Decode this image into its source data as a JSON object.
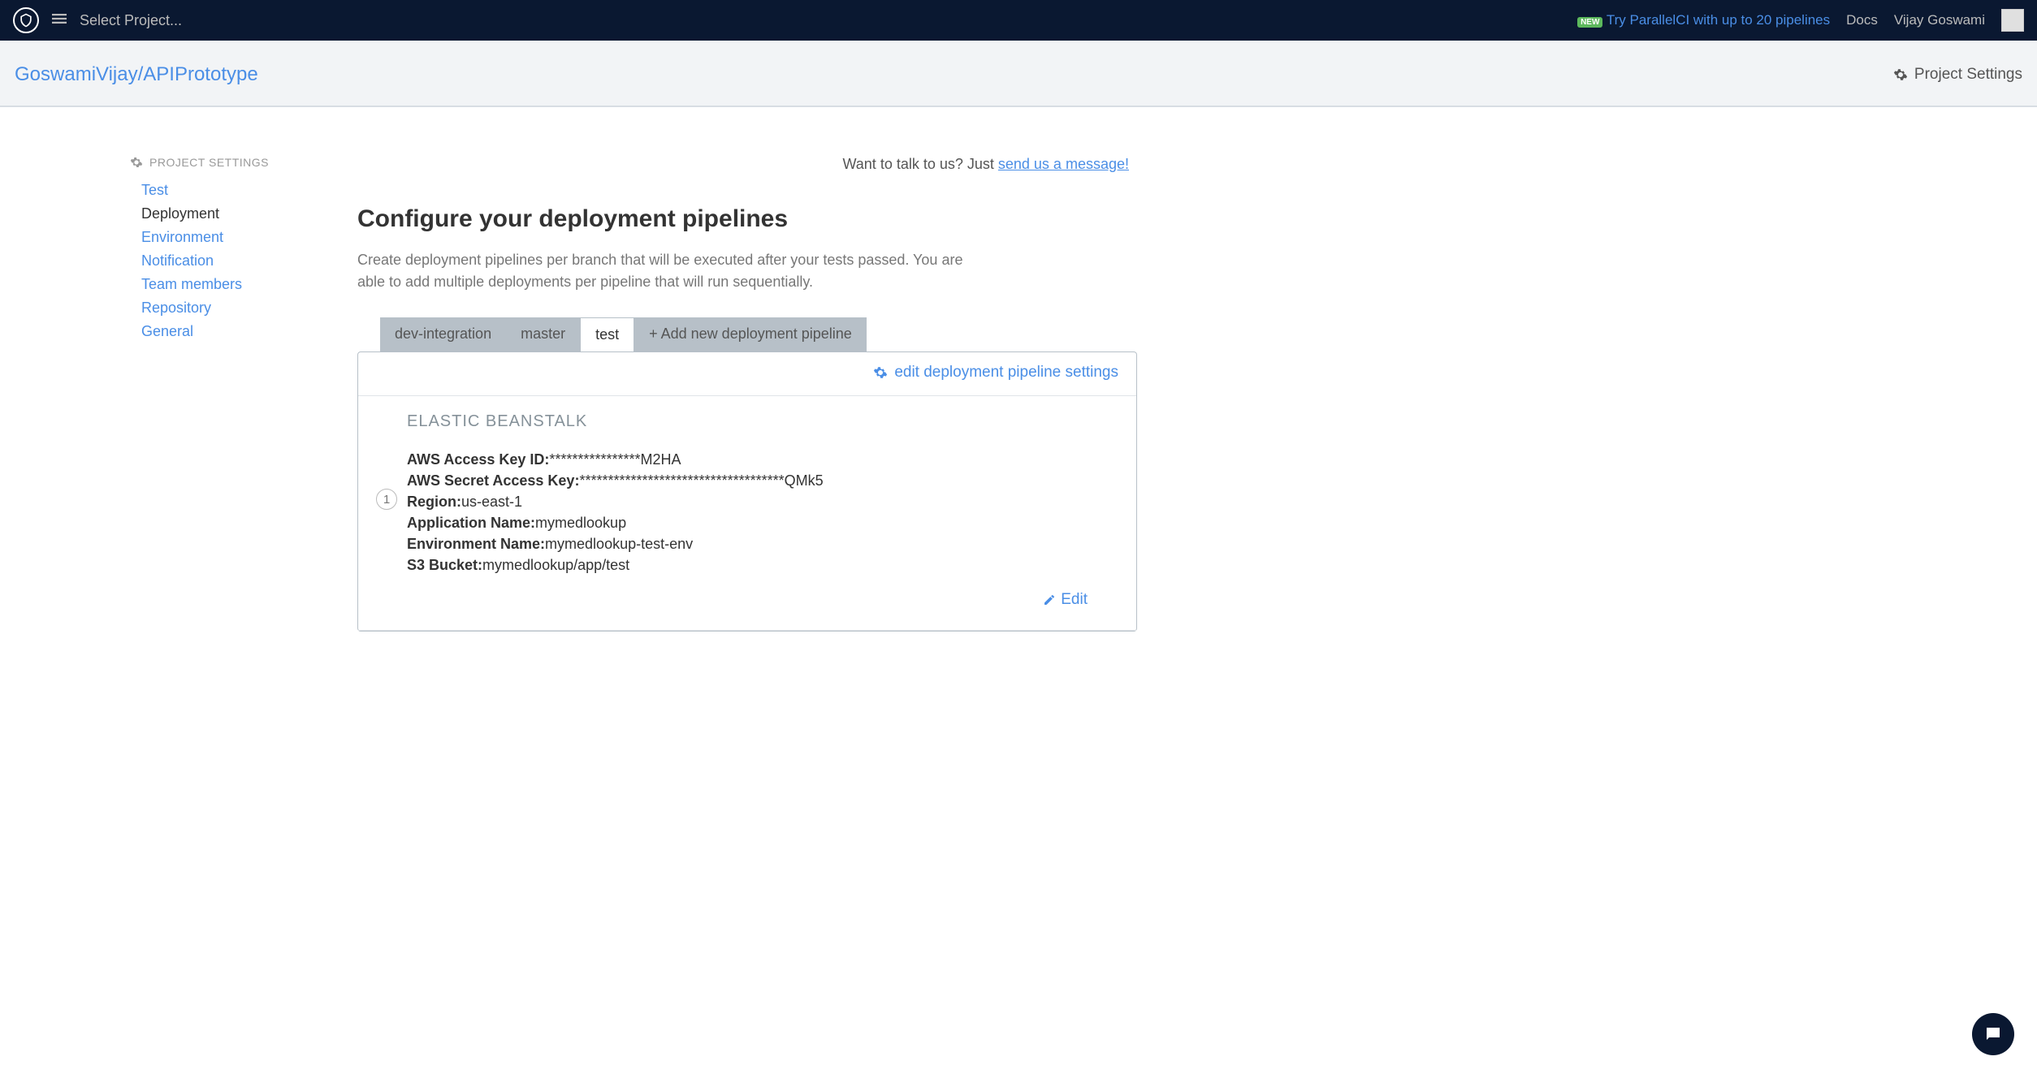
{
  "topbar": {
    "select_project": "Select Project...",
    "new_badge": "NEW",
    "promo": "Try ParallelCI with up to 20 pipelines",
    "docs": "Docs",
    "user": "Vijay Goswami"
  },
  "subheader": {
    "breadcrumb": "GoswamiVijay/APIPrototype",
    "project_settings": "Project Settings"
  },
  "sidebar": {
    "header": "PROJECT SETTINGS",
    "items": [
      {
        "label": "Test",
        "active": false
      },
      {
        "label": "Deployment",
        "active": true
      },
      {
        "label": "Environment",
        "active": false
      },
      {
        "label": "Notification",
        "active": false
      },
      {
        "label": "Team members",
        "active": false
      },
      {
        "label": "Repository",
        "active": false
      },
      {
        "label": "General",
        "active": false
      }
    ]
  },
  "message": {
    "prefix": "Want to talk to us? Just ",
    "link": "send us a message!"
  },
  "page": {
    "title": "Configure your deployment pipelines",
    "desc": "Create deployment pipelines per branch that will be executed after your tests passed. You are able to add multiple deployments per pipeline that will run sequentially."
  },
  "tabs": [
    {
      "label": "dev-integration",
      "active": false
    },
    {
      "label": "master",
      "active": false
    },
    {
      "label": "test",
      "active": true
    },
    {
      "label": "+ Add new deployment pipeline",
      "active": false
    }
  ],
  "panel": {
    "edit_link": "edit deployment pipeline settings",
    "step_num": "1",
    "title": "ELASTIC BEANSTALK",
    "rows": [
      {
        "label": "AWS Access Key ID:",
        "value": "****************M2HA"
      },
      {
        "label": "AWS Secret Access Key:",
        "value": "************************************QMk5"
      },
      {
        "label": "Region:",
        "value": "us-east-1"
      },
      {
        "label": "Application Name:",
        "value": "mymedlookup"
      },
      {
        "label": "Environment Name:",
        "value": "mymedlookup-test-env"
      },
      {
        "label": "S3 Bucket:",
        "value": "mymedlookup/app/test"
      }
    ],
    "edit_btn": "Edit"
  }
}
